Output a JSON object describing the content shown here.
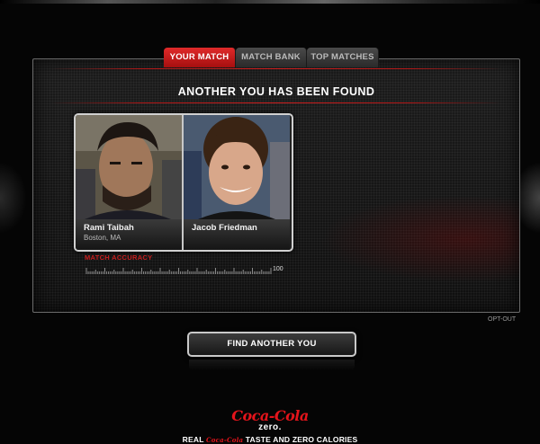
{
  "tabs": [
    {
      "label": "YOUR MATCH",
      "active": true
    },
    {
      "label": "MATCH BANK",
      "active": false
    },
    {
      "label": "TOP MATCHES",
      "active": false
    }
  ],
  "headline": "ANOTHER YOU HAS BEEN FOUND",
  "matches": [
    {
      "name": "Rami Taibah",
      "location": "Boston, MA"
    },
    {
      "name": "Jacob Friedman",
      "location": ""
    }
  ],
  "match_accuracy": {
    "label": "MATCH ACCURACY",
    "scale_max_label": "100"
  },
  "opt_out_label": "OPT-OUT",
  "find_button_label": "FIND ANOTHER YOU",
  "brand": {
    "logo_script": "Coca-Cola",
    "logo_sub": "zero.",
    "tagline_prefix": "REAL",
    "tagline_mini_logo": "Coca-Cola",
    "tagline_suffix": "TASTE AND ZERO CALORIES",
    "brand_red": "#e4141b"
  },
  "colors": {
    "accent_red": "#c81e1e",
    "tab_active": "#d01c1c",
    "background": "#050505"
  }
}
